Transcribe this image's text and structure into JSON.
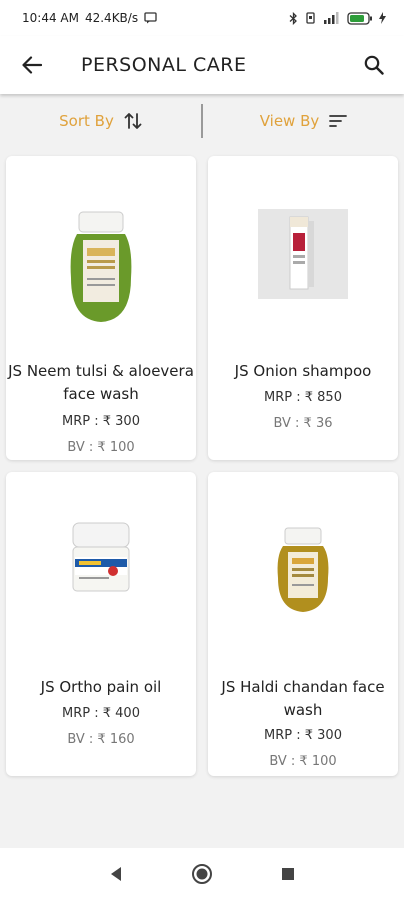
{
  "status_bar": {
    "time": "10:44 AM",
    "speed": "42.4KB/s",
    "icons": [
      "message-icon",
      "bluetooth-icon",
      "vibrate-icon",
      "signal-icon",
      "battery-icon",
      "charging-icon"
    ]
  },
  "app_bar": {
    "title": "PERSONAL CARE",
    "back_icon": "arrow-left-icon",
    "search_icon": "search-icon"
  },
  "sort_bar": {
    "sort_label": "Sort By",
    "view_label": "View By",
    "sort_icon": "sort-arrows-icon",
    "view_icon": "filter-lines-icon"
  },
  "accent_color": "#e0a23c",
  "products": [
    {
      "name": "JS Neem tulsi & aloevera face wash",
      "mrp": "MRP : ₹ 300",
      "bv": "BV : ₹ 100",
      "image": "green-bottle"
    },
    {
      "name": "JS Onion shampoo",
      "mrp": "MRP : ₹ 850",
      "bv": "BV : ₹ 36",
      "image": "shampoo-box"
    },
    {
      "name": "JS Ortho pain oil",
      "mrp": "MRP : ₹ 400",
      "bv": "BV : ₹ 160",
      "image": "ortho-jar"
    },
    {
      "name": "JS Haldi chandan face wash",
      "mrp": "MRP : ₹ 300",
      "bv": "BV : ₹ 100",
      "image": "yellow-bottle"
    }
  ],
  "nav_bar": {
    "back": "nav-back-icon",
    "home": "nav-home-icon",
    "recents": "nav-recents-icon"
  }
}
